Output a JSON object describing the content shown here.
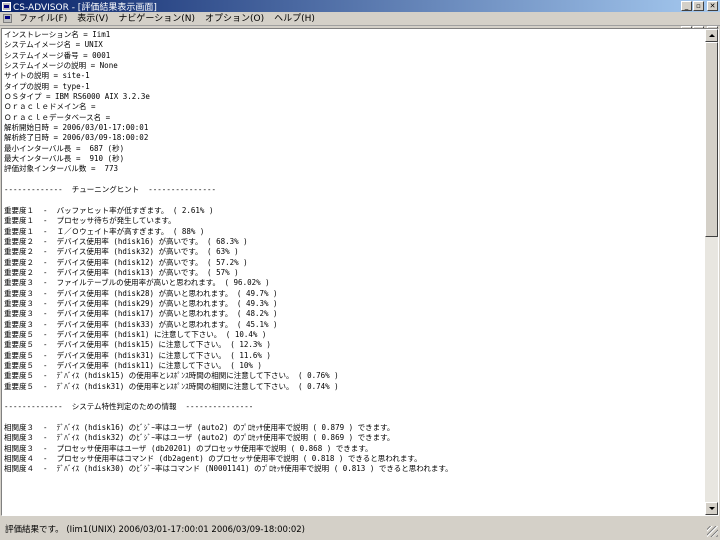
{
  "window": {
    "title": "CS-ADVISOR - [評価結果表示画面]",
    "controls": {
      "minimize": "_",
      "restore": "▫",
      "close": "✕"
    }
  },
  "menu": {
    "items": [
      "ファイル(F)",
      "表示(V)",
      "ナビゲーション(N)",
      "オプション(O)",
      "ヘルプ(H)"
    ],
    "mdi_controls": {
      "minimize": "_",
      "restore": "▫",
      "close": "✕"
    }
  },
  "report": {
    "lines": [
      "インストレーション名 = Iim1",
      "システムイメージ名 = UNIX",
      "システムイメージ番号 = 0001",
      "システムイメージの説明 = None",
      "サイトの説明 = site-1",
      "タイプの説明 = type-1",
      "ＯＳタイプ = IBM RS6000 AIX 3.2.3e",
      "Ｏｒａｃｌｅドメイン名 =",
      "Ｏｒａｃｌｅデータベース名 =",
      "解析開始日時 = 2006/03/01-17:00:01",
      "解析終了日時 = 2006/03/09-18:00:02",
      "最小インターバル長 =  687 (秒)",
      "最大インターバル長 =  910 (秒)",
      "評価対象インターバル数 =  773",
      "",
      "-------------  チューニングヒント  ---------------",
      "",
      "重要度１  -  バッファヒット率が低すぎます。 ( 2.61% )",
      "重要度１  -  プロセッサ待ちが発生しています。",
      "重要度１  -  Ｉ／Ｏウェイト率が高すぎます。 ( 88% )",
      "重要度２  -  デバイス使用率 (hdisk16) が高いです。 ( 68.3% )",
      "重要度２  -  デバイス使用率 (hdisk32) が高いです。 ( 63% )",
      "重要度２  -  デバイス使用率 (hdisk12) が高いです。 ( 57.2% )",
      "重要度２  -  デバイス使用率 (hdisk13) が高いです。 ( 57% )",
      "重要度３  -  ファイルテーブルの使用率が高いと思われます。 ( 96.02% )",
      "重要度３  -  デバイス使用率 (hdisk28) が高いと思われます。 ( 49.7% )",
      "重要度３  -  デバイス使用率 (hdisk29) が高いと思われます。 ( 49.3% )",
      "重要度３  -  デバイス使用率 (hdisk17) が高いと思われます。 ( 48.2% )",
      "重要度３  -  デバイス使用率 (hdisk33) が高いと思われます。 ( 45.1% )",
      "重要度５  -  デバイス使用率 (hdisk1) に注意して下さい。 ( 10.4% )",
      "重要度５  -  デバイス使用率 (hdisk15) に注意して下さい。 ( 12.3% )",
      "重要度５  -  デバイス使用率 (hdisk31) に注意して下さい。 ( 11.6% )",
      "重要度５  -  デバイス使用率 (hdisk11) に注意して下さい。 ( 10% )",
      "重要度５  -  ﾃﾞﾊﾞｲｽ (hdisk15) の使用率とﾚｽﾎﾟﾝｽ時間の相関に注意して下さい。 ( 0.76% )",
      "重要度５  -  ﾃﾞﾊﾞｲｽ (hdisk31) の使用率とﾚｽﾎﾟﾝｽ時間の相関に注意して下さい。 ( 0.74% )",
      "",
      "-------------  システム特性判定のための情報  ---------------",
      "",
      "相関度３  -  ﾃﾞﾊﾞｲｽ (hdisk16) のﾋﾞｼﾞｰ率はユーザ (auto2) のﾌﾟﾛｾｯｻ使用率で説明 ( 0.879 ) できます。",
      "相関度３  -  ﾃﾞﾊﾞｲｽ (hdisk32) のﾋﾞｼﾞｰ率はユーザ (auto2) のﾌﾟﾛｾｯｻ使用率で説明 ( 0.869 ) できます。",
      "相関度３  -  プロセッサ使用率はユーザ (db20201) のプロセッサ使用率で説明 ( 0.868 ) できます。",
      "相関度４  -  プロセッサ使用率はコマンド (db2agent) のプロセッサ使用率で説明 ( 0.818 ) できると思われます。",
      "相関度４  -  ﾃﾞﾊﾞｲｽ (hdisk30) のﾋﾞｼﾞｰ率はコマンド (N0001141) のﾌﾟﾛｾｯｻ使用率で説明 ( 0.813 ) できると思われます。"
    ]
  },
  "status": {
    "text": "評価結果です。 (Iim1(UNIX) 2006/03/01-17:00:01 2006/03/09-18:00:02)"
  }
}
